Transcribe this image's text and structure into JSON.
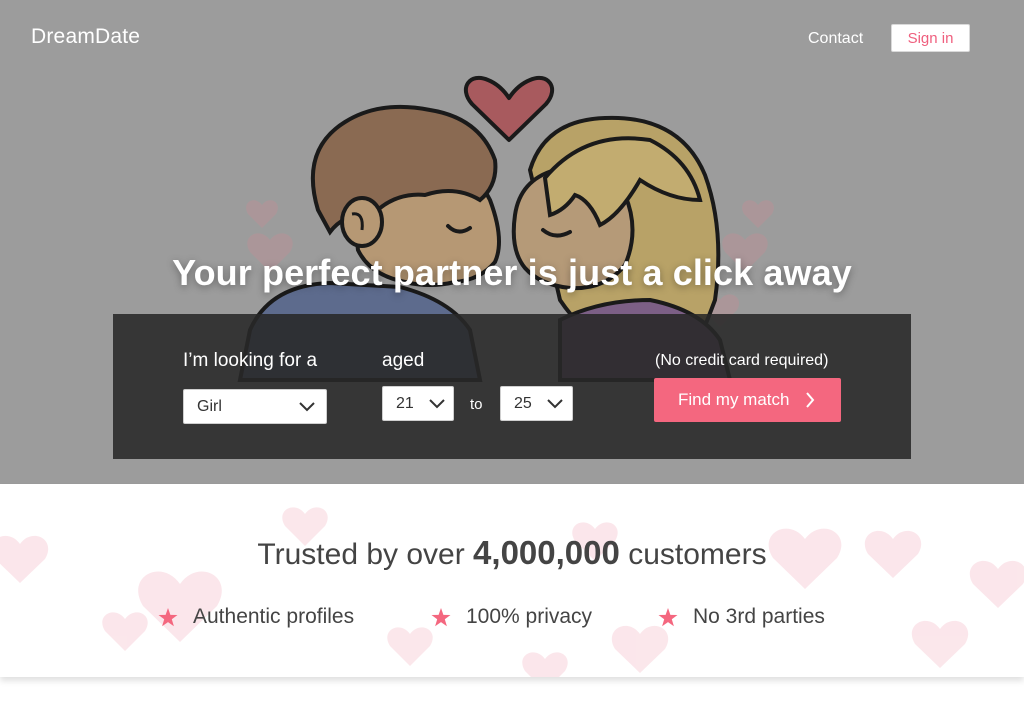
{
  "header": {
    "brand": "DreamDate",
    "contact_label": "Contact",
    "signin_label": "Sign in"
  },
  "hero": {
    "headline": "Your perfect partner is just a click away"
  },
  "search": {
    "looking_label": "I’m looking for a",
    "gender_value": "Girl",
    "aged_label": "aged",
    "age_min": "21",
    "to_label": "to",
    "age_max": "25",
    "note": "(No credit card required)",
    "find_label": "Find my match"
  },
  "trust": {
    "prefix": "Trusted by over ",
    "count": "4,000,000",
    "suffix": " customers",
    "features": [
      {
        "label": "Authentic profiles",
        "icon": "star-icon"
      },
      {
        "label": "100% privacy",
        "icon": "star-icon"
      },
      {
        "label": "No 3rd parties",
        "icon": "star-icon"
      }
    ]
  },
  "colors": {
    "accent": "#f4677f",
    "hero_overlay": "#9c9c9c",
    "panel": "#282828",
    "text_dark": "#444444"
  }
}
